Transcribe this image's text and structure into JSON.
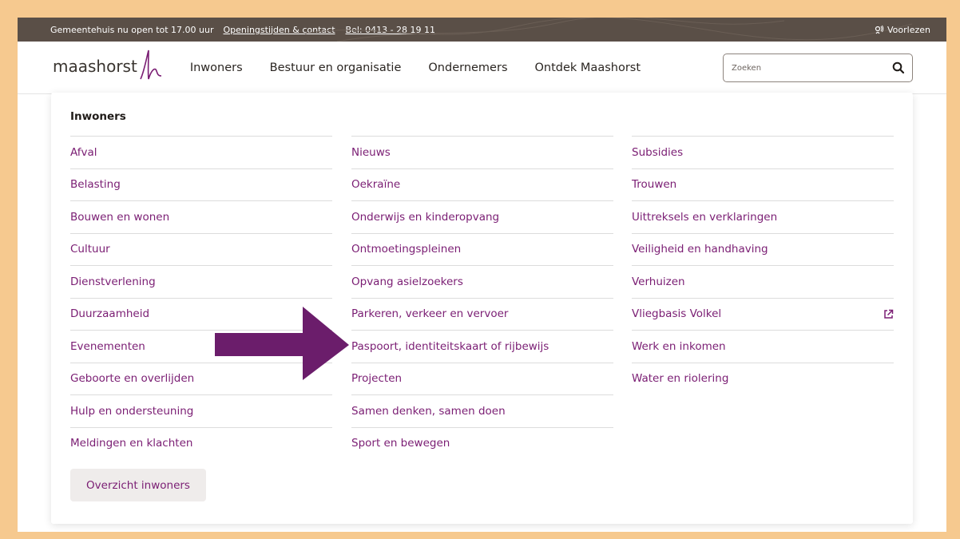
{
  "topbar": {
    "open_text": "Gemeentehuis nu open tot 17.00 uur",
    "links": [
      "Openingstijden & contact",
      "Bel: 0413 - 28 19 11"
    ],
    "read_label": "Voorlezen"
  },
  "header": {
    "logo_text": "maashorst",
    "nav": [
      "Inwoners",
      "Bestuur en organisatie",
      "Ondernemers",
      "Ontdek Maashorst"
    ],
    "search_placeholder": "Zoeken"
  },
  "menu": {
    "title": "Inwoners",
    "columns": [
      [
        "Afval",
        "Belasting",
        "Bouwen en wonen",
        "Cultuur",
        "Dienstverlening",
        "Duurzaamheid",
        "Evenementen",
        "Geboorte en overlijden",
        "Hulp en ondersteuning",
        "Meldingen en klachten"
      ],
      [
        "Nieuws",
        "Oekraïne",
        "Onderwijs en kinderopvang",
        "Ontmoetingspleinen",
        "Opvang asielzoekers",
        "Parkeren, verkeer en vervoer",
        "Paspoort, identiteitskaart of rijbewijs",
        "Projecten",
        "Samen denken, samen doen",
        "Sport en bewegen"
      ],
      [
        "Subsidies",
        "Trouwen",
        "Uittreksels en verklaringen",
        "Veiligheid en handhaving",
        "Verhuizen",
        "Vliegbasis Volkel",
        "Werk en inkomen",
        "Water en riolering"
      ]
    ],
    "overview_button": "Overzicht inwoners"
  },
  "icons": {
    "read": "speaker-icon",
    "search": "search-icon",
    "external": "external-link-icon",
    "arrow": "highlight-arrow"
  },
  "colors": {
    "frame": "#f6c98f",
    "topbar": "#5a4f47",
    "link": "#7a1d73",
    "arrow": "#6b1d6b"
  }
}
